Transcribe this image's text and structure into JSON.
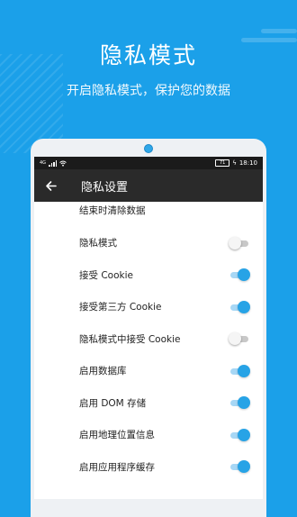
{
  "hero": {
    "title": "隐私模式",
    "subtitle": "开启隐私模式，保护您的数据"
  },
  "statusbar": {
    "network": "4G",
    "battery": "71",
    "time": "18:10"
  },
  "appbar": {
    "title": "隐私设置",
    "back_icon": "arrow-left-icon"
  },
  "settings": {
    "items": [
      {
        "label": "结束时清除数据",
        "toggle": null
      },
      {
        "label": "隐私模式",
        "toggle": false
      },
      {
        "label": "接受 Cookie",
        "toggle": true
      },
      {
        "label": "接受第三方 Cookie",
        "toggle": true
      },
      {
        "label": "隐私模式中接受 Cookie",
        "toggle": false
      },
      {
        "label": "启用数据库",
        "toggle": true
      },
      {
        "label": "启用 DOM 存储",
        "toggle": true
      },
      {
        "label": "启用地理位置信息",
        "toggle": true
      },
      {
        "label": "启用应用程序缓存",
        "toggle": true
      }
    ]
  },
  "colors": {
    "background": "#1ba0e9",
    "accent": "#27a3e6",
    "appbar": "#2a2a2a"
  }
}
